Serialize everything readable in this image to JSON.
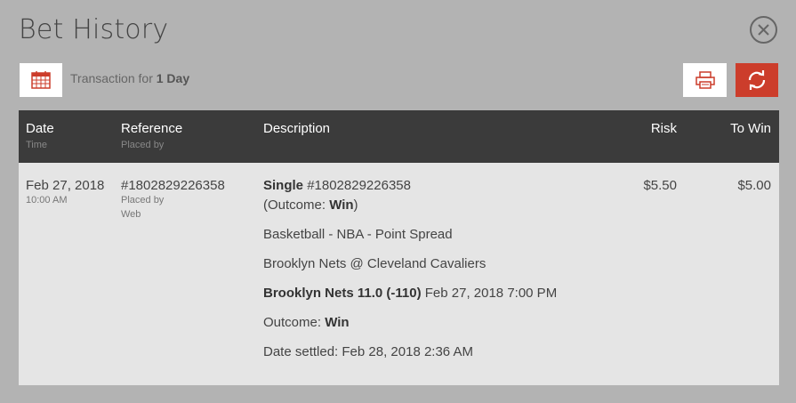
{
  "dialog": {
    "title": "Bet History"
  },
  "toolbar": {
    "transaction_prefix": "Transaction for",
    "transaction_period": "1 Day",
    "accent_color": "#cc3d2b"
  },
  "table": {
    "headers": {
      "date": "Date",
      "date_sub": "Time",
      "reference": "Reference",
      "reference_sub": "Placed by",
      "description": "Description",
      "risk": "Risk",
      "to_win": "To Win"
    },
    "rows": [
      {
        "date": "Feb 27, 2018",
        "time": "10:00 AM",
        "reference": "#1802829226358",
        "placed_by_label": "Placed by",
        "placed_by": "Web",
        "bet_type": "Single",
        "bet_ref": "#1802829226358",
        "outcome_prefix": "(Outcome: ",
        "outcome": "Win",
        "outcome_suffix": ")",
        "market": "Basketball - NBA - Point Spread",
        "matchup": "Brooklyn Nets @ Cleveland Cavaliers",
        "selection": "Brooklyn Nets 11.0 (-110)",
        "event_time": "Feb 27, 2018 7:00 PM",
        "outcome_label": "Outcome: ",
        "outcome2": "Win",
        "settled": "Date settled: Feb 28, 2018 2:36 AM",
        "risk": "$5.50",
        "to_win": "$5.00"
      }
    ]
  }
}
